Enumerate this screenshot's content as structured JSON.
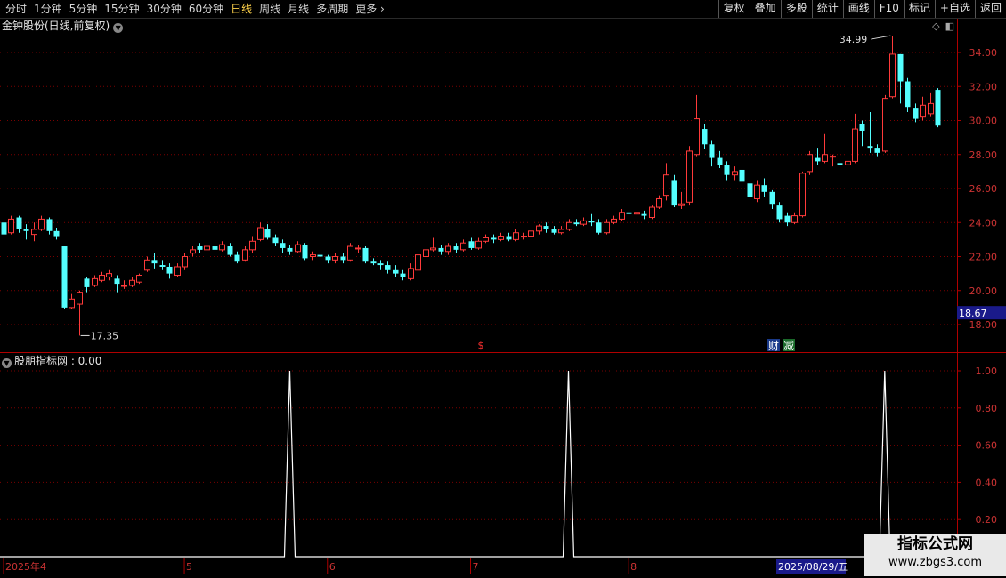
{
  "toolbar": {
    "periods": [
      "分时",
      "1分钟",
      "5分钟",
      "15分钟",
      "30分钟",
      "60分钟",
      "日线",
      "周线",
      "月线",
      "多周期",
      "更多"
    ],
    "active_period": "日线",
    "tools": [
      "复权",
      "叠加",
      "多股",
      "统计",
      "画线",
      "F10",
      "标记",
      "+自选",
      "返回"
    ]
  },
  "main": {
    "title": "金钟股份(日线,前复权)",
    "price_axis": [
      "34.00",
      "32.00",
      "30.00",
      "28.00",
      "26.00",
      "24.00",
      "22.00",
      "20.00",
      "18.00"
    ],
    "current_price": "18.67",
    "high_label": "34.99",
    "low_label": "17.35",
    "markers": {
      "s": "$",
      "cai": "财",
      "jian": "减"
    }
  },
  "indicator": {
    "title": "股朋指标网 : 0.00",
    "axis": [
      "1.00",
      "0.80",
      "0.60",
      "0.40",
      "0.20"
    ]
  },
  "date_axis": {
    "labels": [
      "2025年4",
      "5",
      "6",
      "7",
      "8"
    ],
    "cursor_date": "2025/08/29/五"
  },
  "watermark": {
    "line1": "指标公式网",
    "line2": "www.zbgs3.com"
  },
  "colors": {
    "up": "#ff3a3a",
    "down": "#54ffff",
    "grid": "#7a0000",
    "axis": "#b00000"
  },
  "chart_data": {
    "type": "candlestick",
    "title": "金钟股份(日线,前复权)",
    "ylim": [
      17,
      35.5
    ],
    "high": 34.99,
    "low": 17.35,
    "candles": [
      [
        24.0,
        23.3,
        24.2,
        23.0
      ],
      [
        23.4,
        24.2,
        24.4,
        23.3
      ],
      [
        24.3,
        23.6,
        24.4,
        23.4
      ],
      [
        23.6,
        23.5,
        23.9,
        23.0
      ],
      [
        23.3,
        23.6,
        24.0,
        22.9
      ],
      [
        23.6,
        24.2,
        24.4,
        23.5
      ],
      [
        24.2,
        23.5,
        24.3,
        23.3
      ],
      [
        23.5,
        23.2,
        23.7,
        23.0
      ],
      [
        22.6,
        19.0,
        22.6,
        18.9
      ],
      [
        19.0,
        19.5,
        19.8,
        18.9
      ],
      [
        19.2,
        19.9,
        20.0,
        17.35
      ],
      [
        20.7,
        20.2,
        20.8,
        19.9
      ],
      [
        20.3,
        20.7,
        20.9,
        20.2
      ],
      [
        20.6,
        20.9,
        21.1,
        20.5
      ],
      [
        20.8,
        21.0,
        21.2,
        20.6
      ],
      [
        20.7,
        20.4,
        20.9,
        19.9
      ],
      [
        20.3,
        20.3,
        20.6,
        20.1
      ],
      [
        20.3,
        20.6,
        20.8,
        20.2
      ],
      [
        20.5,
        20.9,
        21.0,
        20.4
      ],
      [
        21.2,
        21.8,
        22.0,
        21.1
      ],
      [
        21.8,
        21.6,
        22.2,
        21.3
      ],
      [
        21.5,
        21.4,
        21.8,
        21.2
      ],
      [
        21.4,
        21.0,
        21.6,
        20.7
      ],
      [
        20.9,
        21.4,
        21.6,
        20.8
      ],
      [
        21.4,
        22.0,
        22.2,
        21.2
      ],
      [
        22.2,
        22.4,
        22.6,
        22.0
      ],
      [
        22.6,
        22.4,
        22.8,
        22.2
      ],
      [
        22.4,
        22.6,
        22.9,
        22.2
      ],
      [
        22.6,
        22.4,
        22.8,
        22.2
      ],
      [
        22.4,
        22.7,
        22.9,
        22.3
      ],
      [
        22.6,
        22.1,
        22.8,
        22.0
      ],
      [
        22.1,
        21.7,
        22.3,
        21.6
      ],
      [
        21.8,
        22.4,
        22.6,
        21.7
      ],
      [
        22.4,
        22.9,
        23.2,
        22.2
      ],
      [
        23.0,
        23.7,
        24.0,
        22.9
      ],
      [
        23.6,
        23.1,
        23.9,
        23.0
      ],
      [
        23.1,
        22.8,
        23.3,
        22.6
      ],
      [
        22.8,
        22.5,
        23.0,
        22.2
      ],
      [
        22.5,
        22.3,
        22.7,
        22.1
      ],
      [
        22.3,
        22.7,
        22.9,
        22.2
      ],
      [
        22.7,
        21.9,
        22.8,
        21.8
      ],
      [
        22.0,
        22.1,
        22.3,
        21.8
      ],
      [
        22.1,
        22.0,
        22.2,
        21.8
      ],
      [
        22.0,
        21.8,
        22.1,
        21.6
      ],
      [
        21.8,
        22.0,
        22.2,
        21.6
      ],
      [
        22.0,
        21.8,
        22.2,
        21.6
      ],
      [
        21.8,
        22.6,
        22.8,
        21.7
      ],
      [
        22.5,
        22.5,
        22.7,
        22.2
      ],
      [
        22.5,
        21.7,
        22.6,
        21.6
      ],
      [
        21.7,
        21.6,
        21.9,
        21.5
      ],
      [
        21.6,
        21.5,
        21.8,
        21.2
      ],
      [
        21.5,
        21.2,
        21.7,
        21.0
      ],
      [
        21.2,
        21.0,
        21.5,
        20.8
      ],
      [
        21.0,
        20.8,
        21.2,
        20.6
      ],
      [
        20.7,
        21.3,
        21.6,
        20.6
      ],
      [
        21.2,
        22.1,
        22.3,
        21.1
      ],
      [
        22.0,
        22.4,
        22.6,
        21.9
      ],
      [
        22.4,
        22.5,
        23.1,
        22.3
      ],
      [
        22.5,
        22.3,
        22.7,
        22.1
      ],
      [
        22.3,
        22.6,
        22.8,
        22.1
      ],
      [
        22.6,
        22.4,
        22.8,
        22.2
      ],
      [
        22.4,
        22.8,
        23.0,
        22.3
      ],
      [
        22.9,
        22.5,
        23.1,
        22.4
      ],
      [
        22.5,
        22.9,
        23.1,
        22.4
      ],
      [
        22.9,
        23.1,
        23.3,
        22.8
      ],
      [
        23.1,
        23.0,
        23.3,
        22.8
      ],
      [
        23.0,
        23.2,
        23.4,
        22.9
      ],
      [
        23.2,
        23.0,
        23.4,
        22.9
      ],
      [
        23.0,
        23.4,
        23.6,
        22.9
      ],
      [
        23.2,
        23.2,
        23.4,
        23.0
      ],
      [
        23.2,
        23.5,
        23.7,
        23.1
      ],
      [
        23.5,
        23.8,
        23.9,
        23.3
      ],
      [
        23.8,
        23.6,
        24.0,
        23.4
      ],
      [
        23.6,
        23.4,
        23.8,
        23.3
      ],
      [
        23.4,
        23.6,
        23.8,
        23.3
      ],
      [
        23.6,
        24.0,
        24.2,
        23.5
      ],
      [
        24.0,
        23.9,
        24.2,
        23.8
      ],
      [
        23.9,
        24.1,
        24.3,
        23.8
      ],
      [
        24.1,
        24.0,
        24.5,
        23.8
      ],
      [
        24.0,
        23.4,
        24.2,
        23.3
      ],
      [
        23.4,
        24.0,
        24.2,
        23.3
      ],
      [
        24.0,
        24.2,
        24.4,
        23.9
      ],
      [
        24.2,
        24.6,
        24.8,
        24.1
      ],
      [
        24.6,
        24.5,
        24.8,
        24.3
      ],
      [
        24.5,
        24.6,
        24.8,
        24.3
      ],
      [
        24.5,
        24.4,
        24.7,
        24.2
      ],
      [
        24.3,
        24.9,
        25.0,
        24.2
      ],
      [
        24.9,
        25.4,
        25.6,
        24.8
      ],
      [
        25.6,
        26.8,
        27.5,
        25.3
      ],
      [
        26.5,
        25.0,
        26.8,
        24.9
      ],
      [
        25.0,
        25.1,
        25.8,
        24.8
      ],
      [
        25.2,
        28.2,
        28.5,
        25.0
      ],
      [
        28.0,
        30.1,
        31.5,
        27.9
      ],
      [
        29.5,
        28.6,
        29.8,
        28.3
      ],
      [
        28.6,
        27.8,
        28.8,
        27.3
      ],
      [
        27.8,
        27.4,
        28.2,
        27.2
      ],
      [
        27.4,
        26.8,
        27.6,
        26.5
      ],
      [
        26.8,
        27.0,
        27.3,
        26.5
      ],
      [
        27.1,
        26.4,
        27.4,
        26.2
      ],
      [
        26.3,
        25.5,
        26.6,
        24.8
      ],
      [
        25.4,
        26.2,
        26.5,
        25.2
      ],
      [
        26.2,
        25.8,
        26.6,
        25.5
      ],
      [
        25.8,
        25.1,
        25.9,
        24.8
      ],
      [
        25.0,
        24.2,
        25.2,
        24.0
      ],
      [
        24.4,
        24.0,
        24.6,
        23.8
      ],
      [
        24.0,
        24.4,
        24.6,
        23.9
      ],
      [
        24.4,
        26.9,
        27.0,
        24.3
      ],
      [
        27.0,
        28.0,
        28.2,
        26.8
      ],
      [
        27.8,
        27.6,
        28.4,
        27.4
      ],
      [
        27.6,
        28.0,
        29.2,
        27.5
      ],
      [
        27.9,
        27.9,
        28.0,
        27.3
      ],
      [
        27.5,
        27.4,
        28.0,
        27.2
      ],
      [
        27.4,
        27.6,
        28.0,
        27.3
      ],
      [
        27.6,
        29.5,
        30.4,
        27.5
      ],
      [
        29.8,
        29.4,
        30.0,
        28.5
      ],
      [
        28.5,
        28.4,
        30.5,
        28.1
      ],
      [
        28.4,
        28.1,
        28.6,
        27.9
      ],
      [
        28.2,
        31.3,
        31.5,
        28.1
      ],
      [
        31.4,
        33.9,
        34.99,
        31.3
      ],
      [
        33.9,
        32.3,
        33.9,
        31.0
      ],
      [
        32.3,
        30.8,
        32.5,
        30.5
      ],
      [
        30.7,
        30.1,
        31.0,
        29.9
      ],
      [
        30.2,
        30.9,
        31.4,
        30.0
      ],
      [
        30.4,
        31.0,
        31.6,
        30.2
      ],
      [
        31.8,
        29.7,
        31.9,
        29.6
      ]
    ],
    "indicator": {
      "name": "股朋指标网",
      "value": "0.00",
      "ylim": [
        0,
        1.05
      ],
      "spikes_at_index": [
        38,
        75,
        117
      ],
      "spike_value": 1.0,
      "base_value": 0.0
    }
  }
}
